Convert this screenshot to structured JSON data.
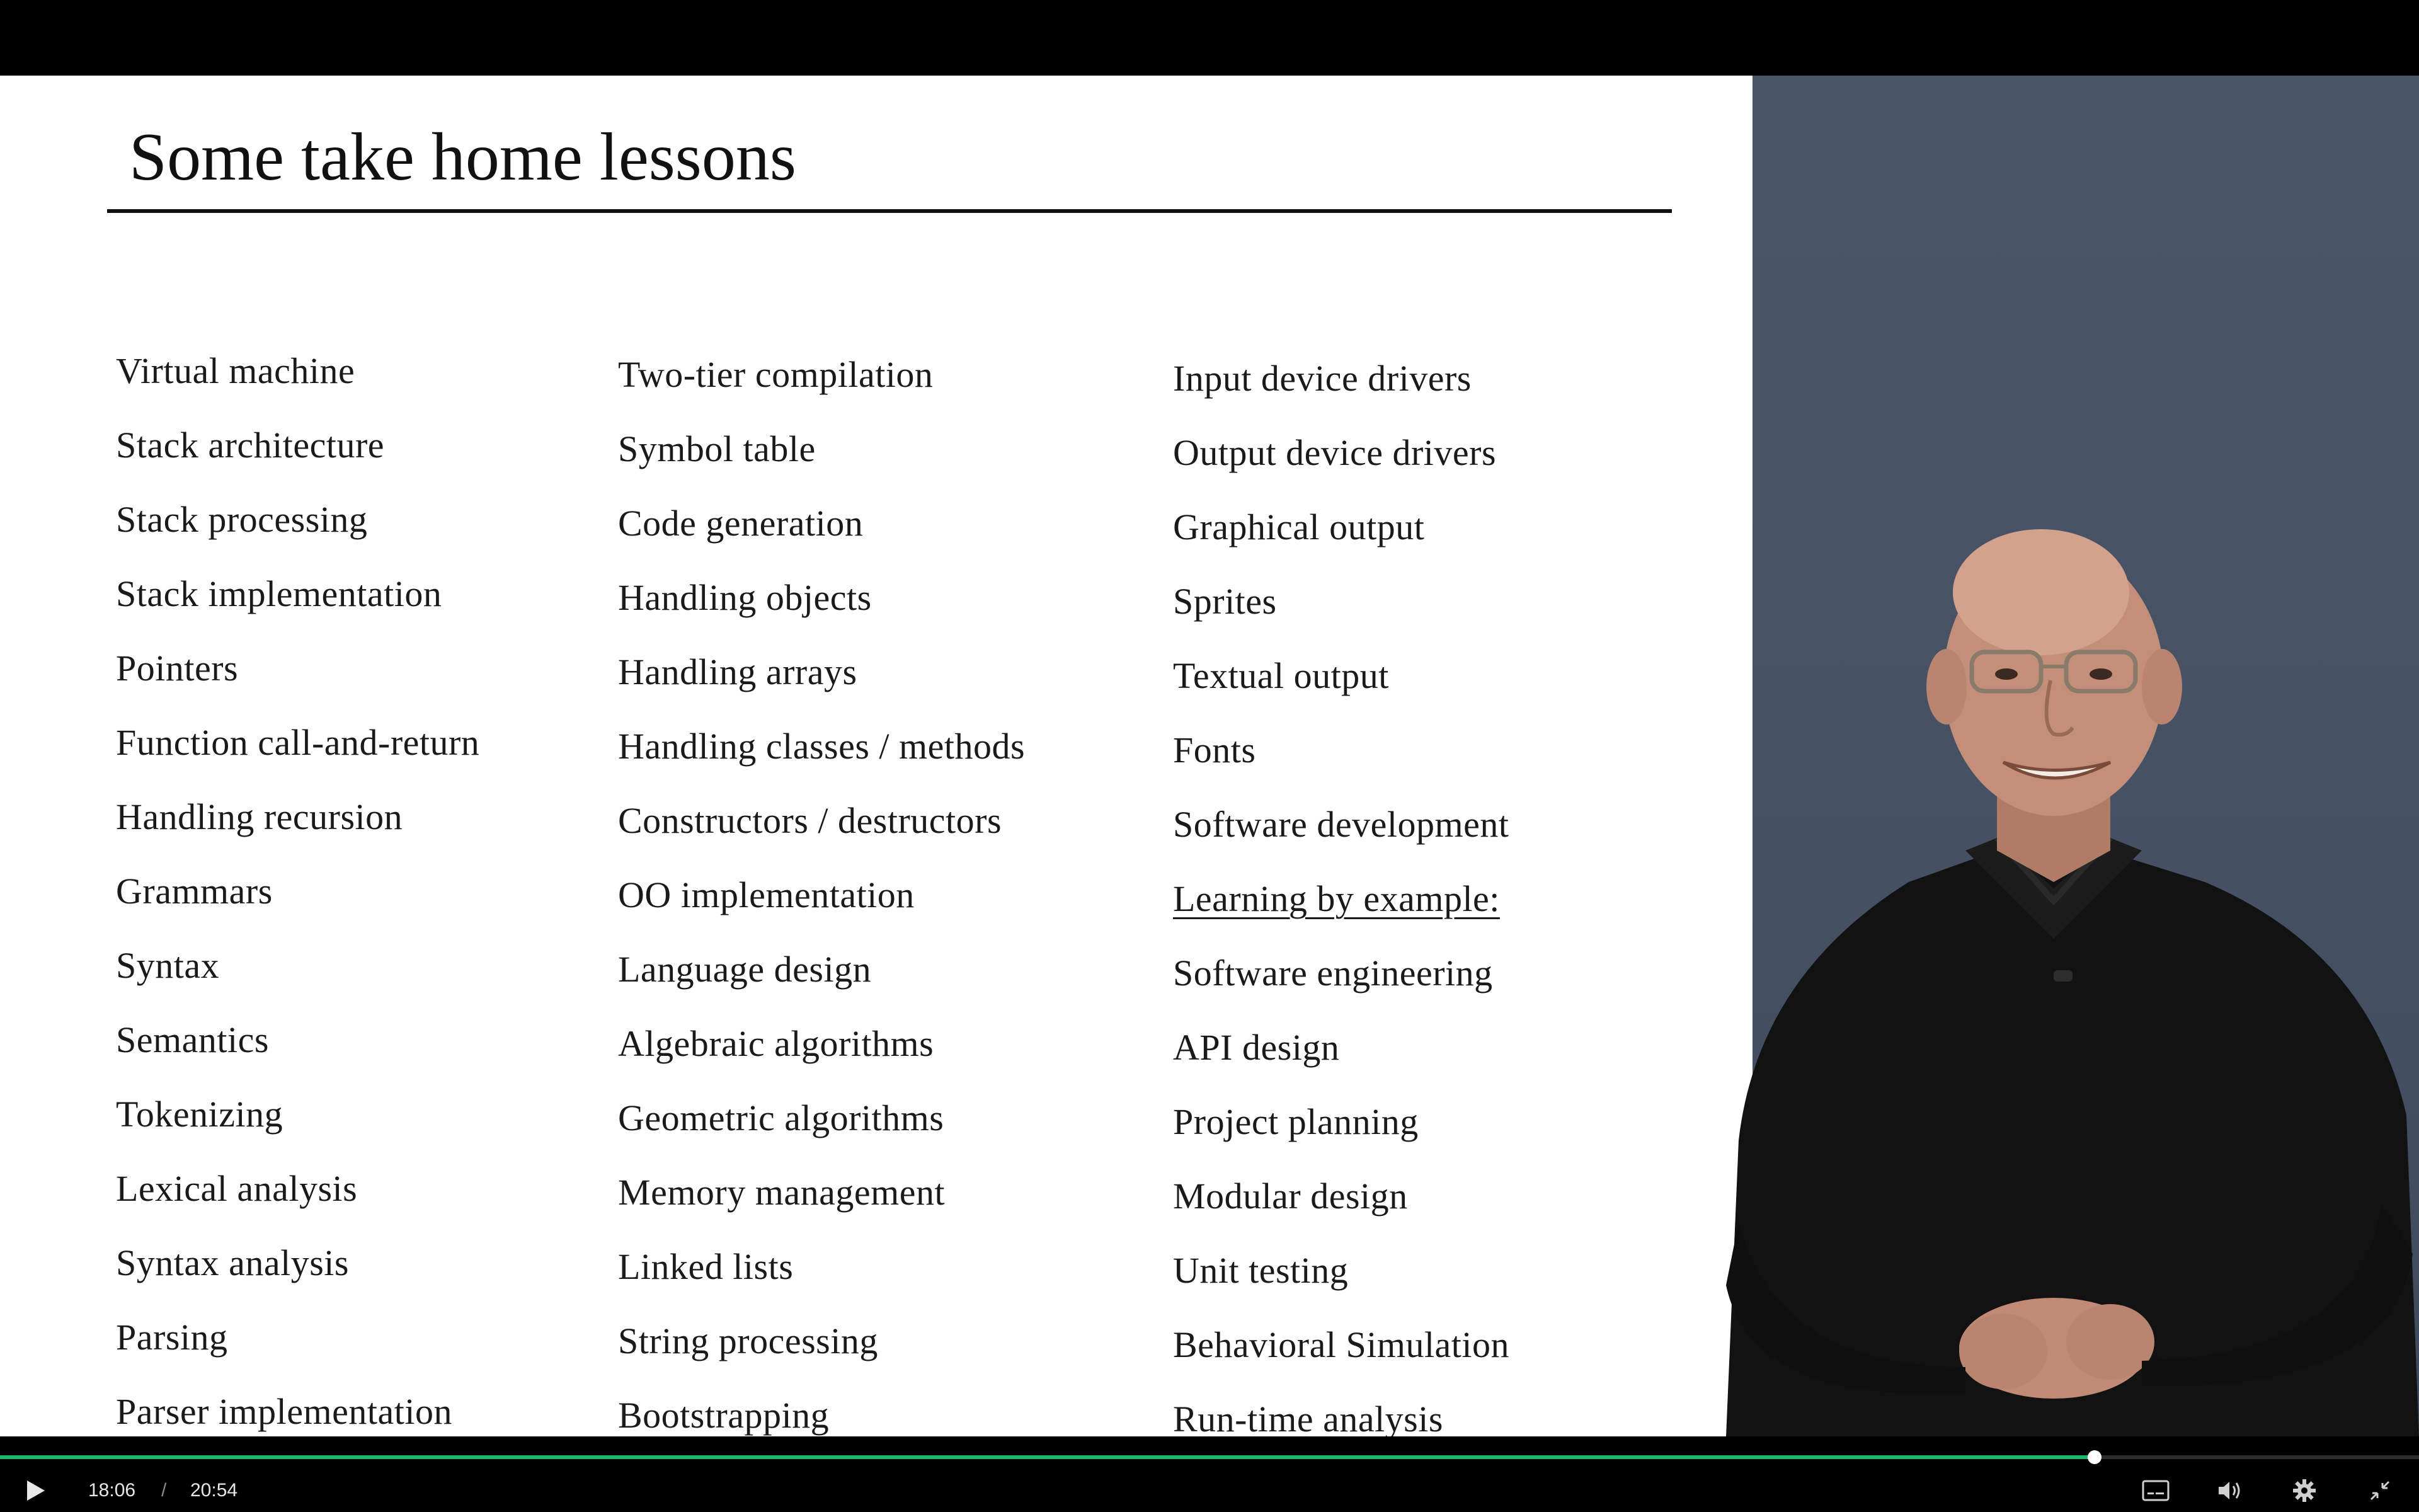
{
  "slide": {
    "title": "Some take home lessons",
    "columns": [
      {
        "items": [
          "Virtual machine",
          "Stack architecture",
          "Stack processing",
          "Stack implementation",
          "Pointers",
          "Function call-and-return",
          "Handling recursion",
          "Grammars",
          "Syntax",
          "Semantics",
          "Tokenizing",
          "Lexical analysis",
          "Syntax  analysis",
          "Parsing",
          "Parser implementation"
        ]
      },
      {
        "items": [
          "Two-tier compilation",
          "Symbol  table",
          "Code generation",
          "Handling  objects",
          "Handling  arrays",
          "Handling  classes  /  methods",
          "Constructors  /  destructors",
          "OO  implementation",
          "Language  design",
          "Algebraic  algorithms",
          "Geometric  algorithms",
          "Memory  management",
          "Linked  lists",
          "String  processing",
          "Bootstrapping"
        ]
      },
      {
        "items": [
          "Input  device  drivers",
          "Output  device  drivers",
          "Graphical  output",
          "Sprites",
          "Textual  output",
          "Fonts",
          "Software  development",
          "Learning  by  example:",
          "Software  engineering",
          "API  design",
          "Project  planning",
          "Modular  design",
          "Unit  testing",
          "Behavioral  Simulation",
          "Run-time  analysis"
        ]
      }
    ]
  },
  "player": {
    "current_time": "18:06",
    "separator": "/",
    "duration": "20:54",
    "progress_fraction": 0.866,
    "accent_color": "#1fb66a",
    "icons": {
      "play": "play-icon",
      "captions": "captions-icon",
      "volume": "volume-icon",
      "settings": "gear-icon",
      "fullscreen": "exit-fullscreen-icon"
    }
  },
  "colors": {
    "slide_background": "#ffffff",
    "speaker_background": "#4b5668",
    "player_background": "#000000"
  }
}
